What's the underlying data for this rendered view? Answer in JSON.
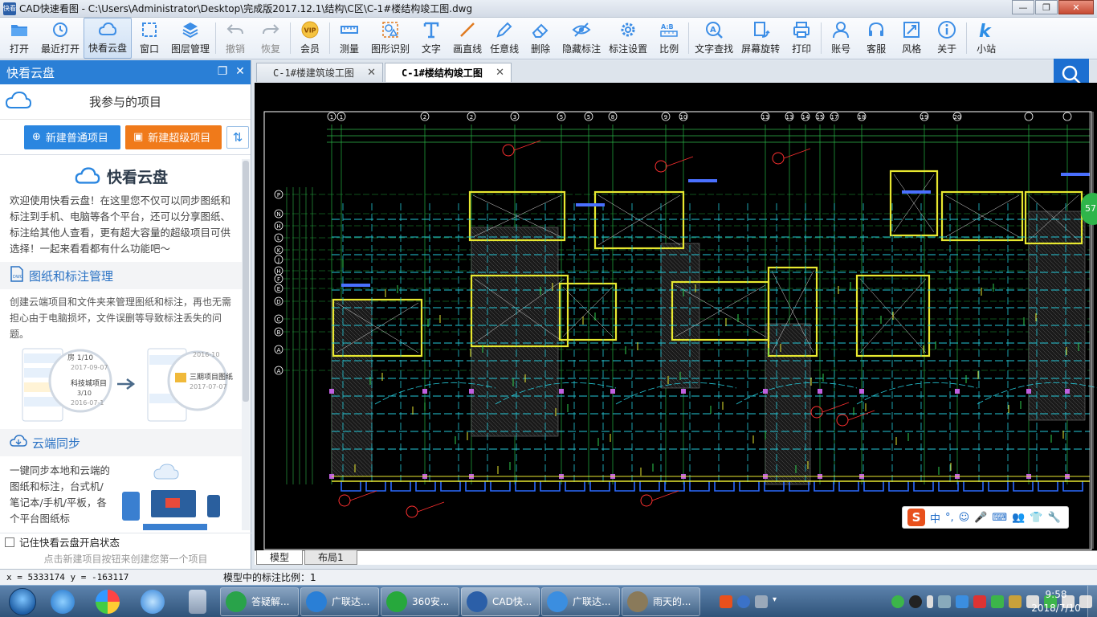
{
  "window": {
    "icon_text": "快看",
    "title": "CAD快速看图 - C:\\Users\\Administrator\\Desktop\\完成版2017.12.1\\结构\\C区\\C-1#楼结构竣工图.dwg",
    "controls": [
      "—",
      "❐",
      "✕"
    ]
  },
  "toolbar": [
    {
      "label": "打开",
      "icon": "folder-icon"
    },
    {
      "label": "最近打开",
      "icon": "history-icon"
    },
    {
      "label": "快看云盘",
      "icon": "cloud-icon",
      "active": true
    },
    {
      "label": "窗口",
      "icon": "window-icon"
    },
    {
      "label": "图层管理",
      "icon": "layers-icon"
    },
    {
      "label": "撤销",
      "icon": "undo-icon",
      "disabled": true
    },
    {
      "label": "恢复",
      "icon": "redo-icon",
      "disabled": true
    },
    {
      "label": "会员",
      "icon": "vip-icon",
      "badge": "VIP"
    },
    {
      "label": "测量",
      "icon": "ruler-icon"
    },
    {
      "label": "图形识别",
      "icon": "shape-recognize-icon"
    },
    {
      "label": "文字",
      "icon": "text-icon"
    },
    {
      "label": "画直线",
      "icon": "line-icon"
    },
    {
      "label": "任意线",
      "icon": "pen-icon"
    },
    {
      "label": "删除",
      "icon": "eraser-icon"
    },
    {
      "label": "隐藏标注",
      "icon": "eye-hide-icon"
    },
    {
      "label": "标注设置",
      "icon": "settings-icon"
    },
    {
      "label": "比例",
      "icon": "scale-icon",
      "badge": "A:B"
    },
    {
      "label": "文字查找",
      "icon": "text-search-icon"
    },
    {
      "label": "屏幕旋转",
      "icon": "rotate-icon"
    },
    {
      "label": "打印",
      "icon": "printer-icon"
    },
    {
      "label": "账号",
      "icon": "user-icon"
    },
    {
      "label": "客服",
      "icon": "headset-icon"
    },
    {
      "label": "风格",
      "icon": "style-icon"
    },
    {
      "label": "关于",
      "icon": "info-icon"
    },
    {
      "label": "小站",
      "icon": "k-icon"
    }
  ],
  "cloud_panel": {
    "header": "快看云盘",
    "projects_title": "我参与的项目",
    "new_normal": "新建普通项目",
    "new_super": "新建超级项目",
    "brand": "快看云盘",
    "intro": "欢迎使用快看云盘！在这里您不仅可以同步图纸和标注到手机、电脑等各个平台，还可以分享图纸、标注给其他人查看，更有超大容量的超级项目可供选择！一起来看看都有什么功能吧～",
    "section1_title": "图纸和标注管理",
    "section1_text": "创建云端项目和文件夹来管理图纸和标注，再也无需担心由于电脑损坏，文件误删等导致标注丢失的问题。",
    "illus_left_lines": [
      "房 1/10",
      "2017-09-07",
      "科技城项目",
      "3/10",
      "2016-07-1"
    ],
    "illus_right_lines": [
      "2016-10",
      "三期项目图纸",
      "2017-07-07"
    ],
    "section2_title": "云端同步",
    "section2_text": "一键同步本地和云端的图纸和标注，台式机/笔记本/手机/平板，各个平台图纸标",
    "remember": "记住快看云盘开启状态",
    "hint": "点击新建项目按钮来创建您第一个项目"
  },
  "doc_tabs": [
    {
      "label": "C-1#楼建筑竣工图",
      "active": false
    },
    {
      "label": "C-1#楼结构竣工图",
      "active": true
    }
  ],
  "layout_tabs": [
    {
      "label": "模型",
      "active": true
    },
    {
      "label": "布局1",
      "active": false
    }
  ],
  "drawing": {
    "col_labels": [
      "1",
      "1",
      "2",
      "2",
      "3",
      "5",
      "5",
      "8",
      "9",
      "10",
      "13",
      "13",
      "14",
      "15",
      "17",
      "18",
      "19",
      "20"
    ],
    "row_labels": [
      "P",
      "N",
      "H",
      "L",
      "K",
      "J",
      "H",
      "F",
      "E",
      "D",
      "C",
      "B",
      "A",
      "A"
    ],
    "badge": "57"
  },
  "ime": {
    "logo": "S",
    "mode": "中",
    "punct": "°,"
  },
  "statusbar": {
    "coords": "x = 5333174 y = -163117",
    "scale": "模型中的标注比例：1"
  },
  "taskbar": {
    "tasks": [
      {
        "label": "答疑解...",
        "color": "#29a34a"
      },
      {
        "label": "广联达...",
        "color": "#2a7fd6"
      },
      {
        "label": "360安...",
        "color": "#27a83c"
      },
      {
        "label": "CAD快...",
        "color": "#2b5fa8",
        "active": true
      },
      {
        "label": "广联达...",
        "color": "#3b8ee0"
      },
      {
        "label": "雨天的...",
        "color": "#8a7a5a"
      }
    ],
    "time": "9:58",
    "date": "2018/7/10"
  }
}
